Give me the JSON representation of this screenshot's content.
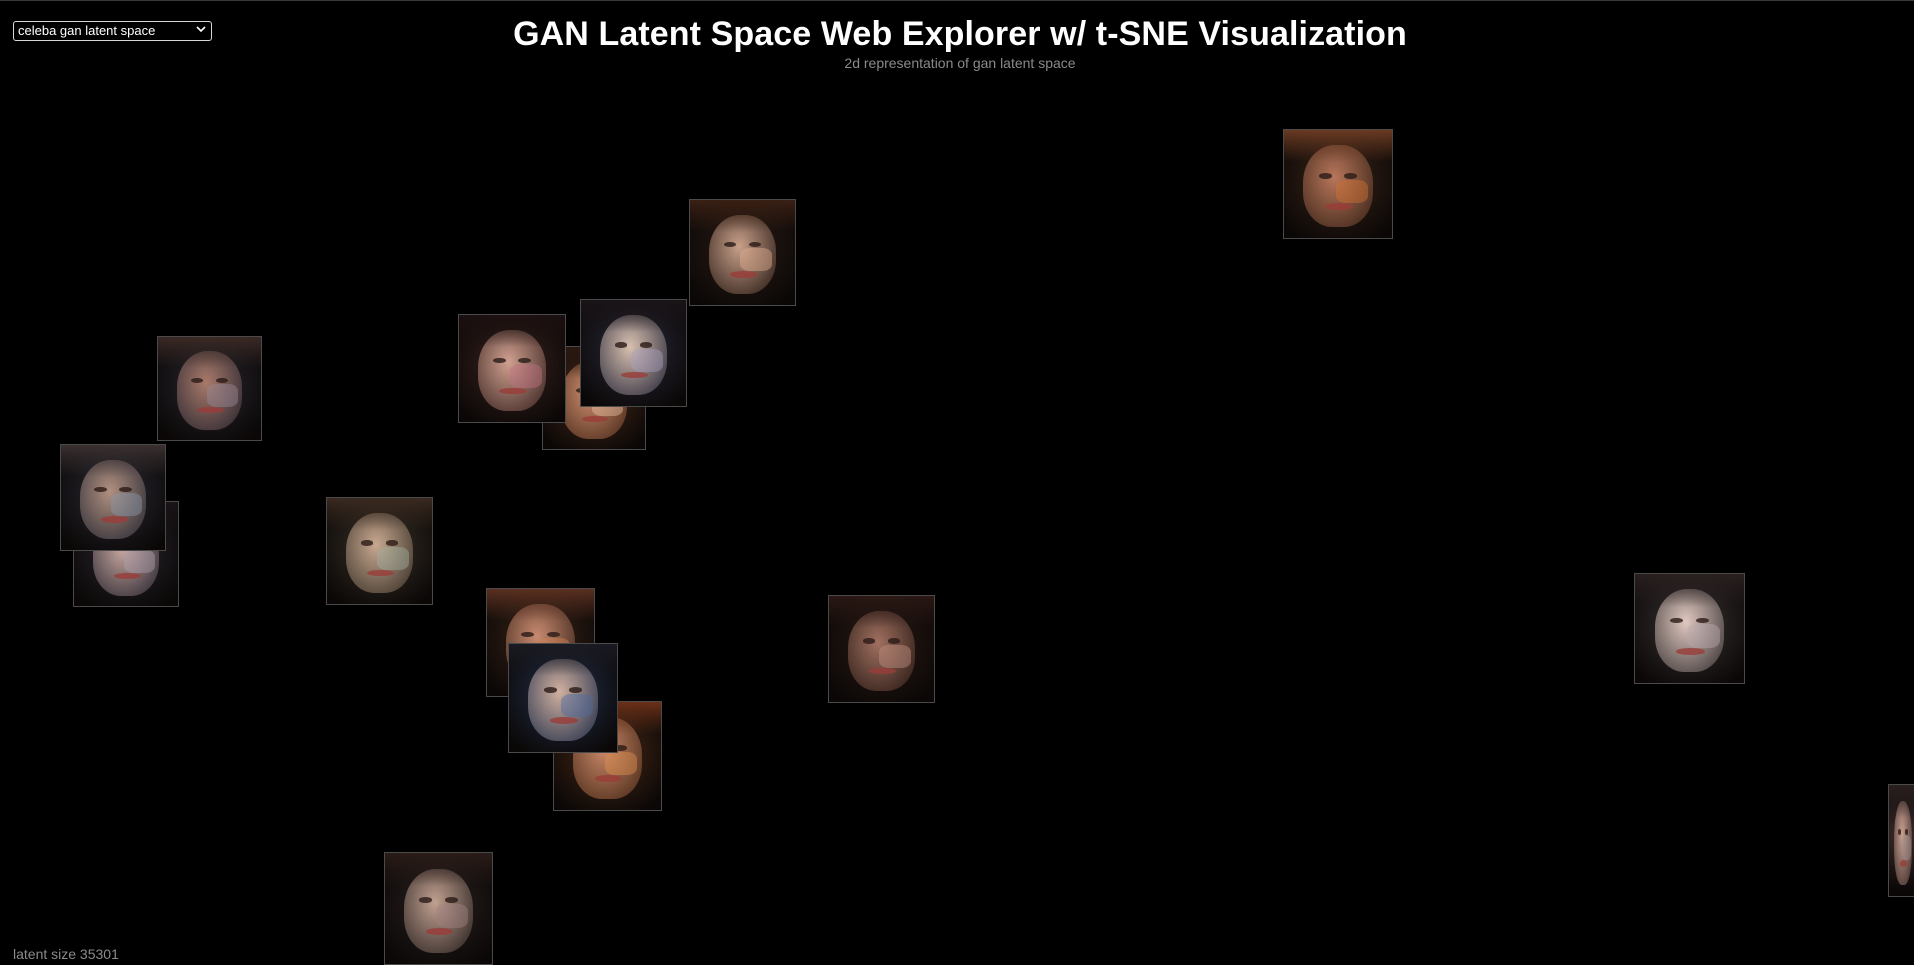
{
  "header": {
    "title": "GAN Latent Space Web Explorer w/ t-SNE Visualization",
    "subtitle": "2d representation of gan latent space"
  },
  "model_select": {
    "selected": "celeba gan latent space",
    "options": [
      "celeba gan latent space"
    ]
  },
  "footer": {
    "latent_size": "latent size 35301"
  },
  "icons": {
    "select": "chevron-down-icon",
    "thumbnail": "generated-face-icon"
  },
  "colors": {
    "background": "#000000",
    "title": "#ffffff",
    "muted_text": "#8a8a8a"
  }
}
